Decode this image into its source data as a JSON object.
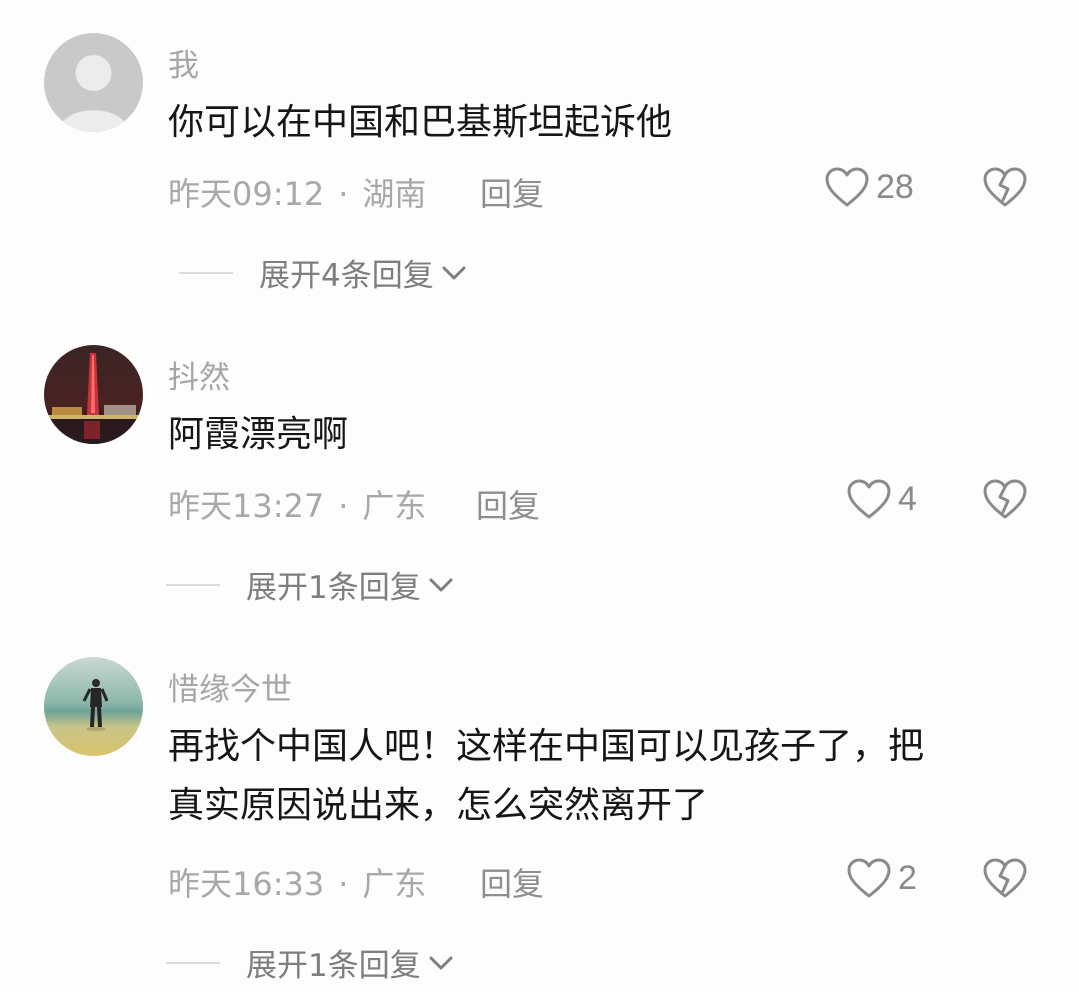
{
  "comments": [
    {
      "username": "我",
      "text": "你可以在中国和巴基斯坦起诉他",
      "time": "昨天09:12",
      "dot": "·",
      "location": "湖南",
      "reply_label": "回复",
      "likes": "28",
      "expand_label": "展开4条回复"
    },
    {
      "username": "抖然",
      "text": "阿霞漂亮啊",
      "time": "昨天13:27",
      "dot": "·",
      "location": "广东",
      "reply_label": "回复",
      "likes": "4",
      "expand_label": "展开1条回复"
    },
    {
      "username": "惜缘今世",
      "text_line1": "再找个中国人吧！这样在中国可以见孩子了，把",
      "text_line2": "真实原因说出来，怎么突然离开了",
      "time": "昨天16:33",
      "dot": "·",
      "location": "广东",
      "reply_label": "回复",
      "likes": "2",
      "expand_label": "展开1条回复"
    }
  ],
  "icons": {
    "like": "heart-outline-icon",
    "dislike": "broken-heart-icon",
    "expand": "chevron-down-icon"
  },
  "colors": {
    "background": "#fdfdfd",
    "username": "#a6a6a6",
    "content": "#161616",
    "meta": "#a8a8a8",
    "reply": "#8e8e8e",
    "expand": "#7e7e7e"
  }
}
